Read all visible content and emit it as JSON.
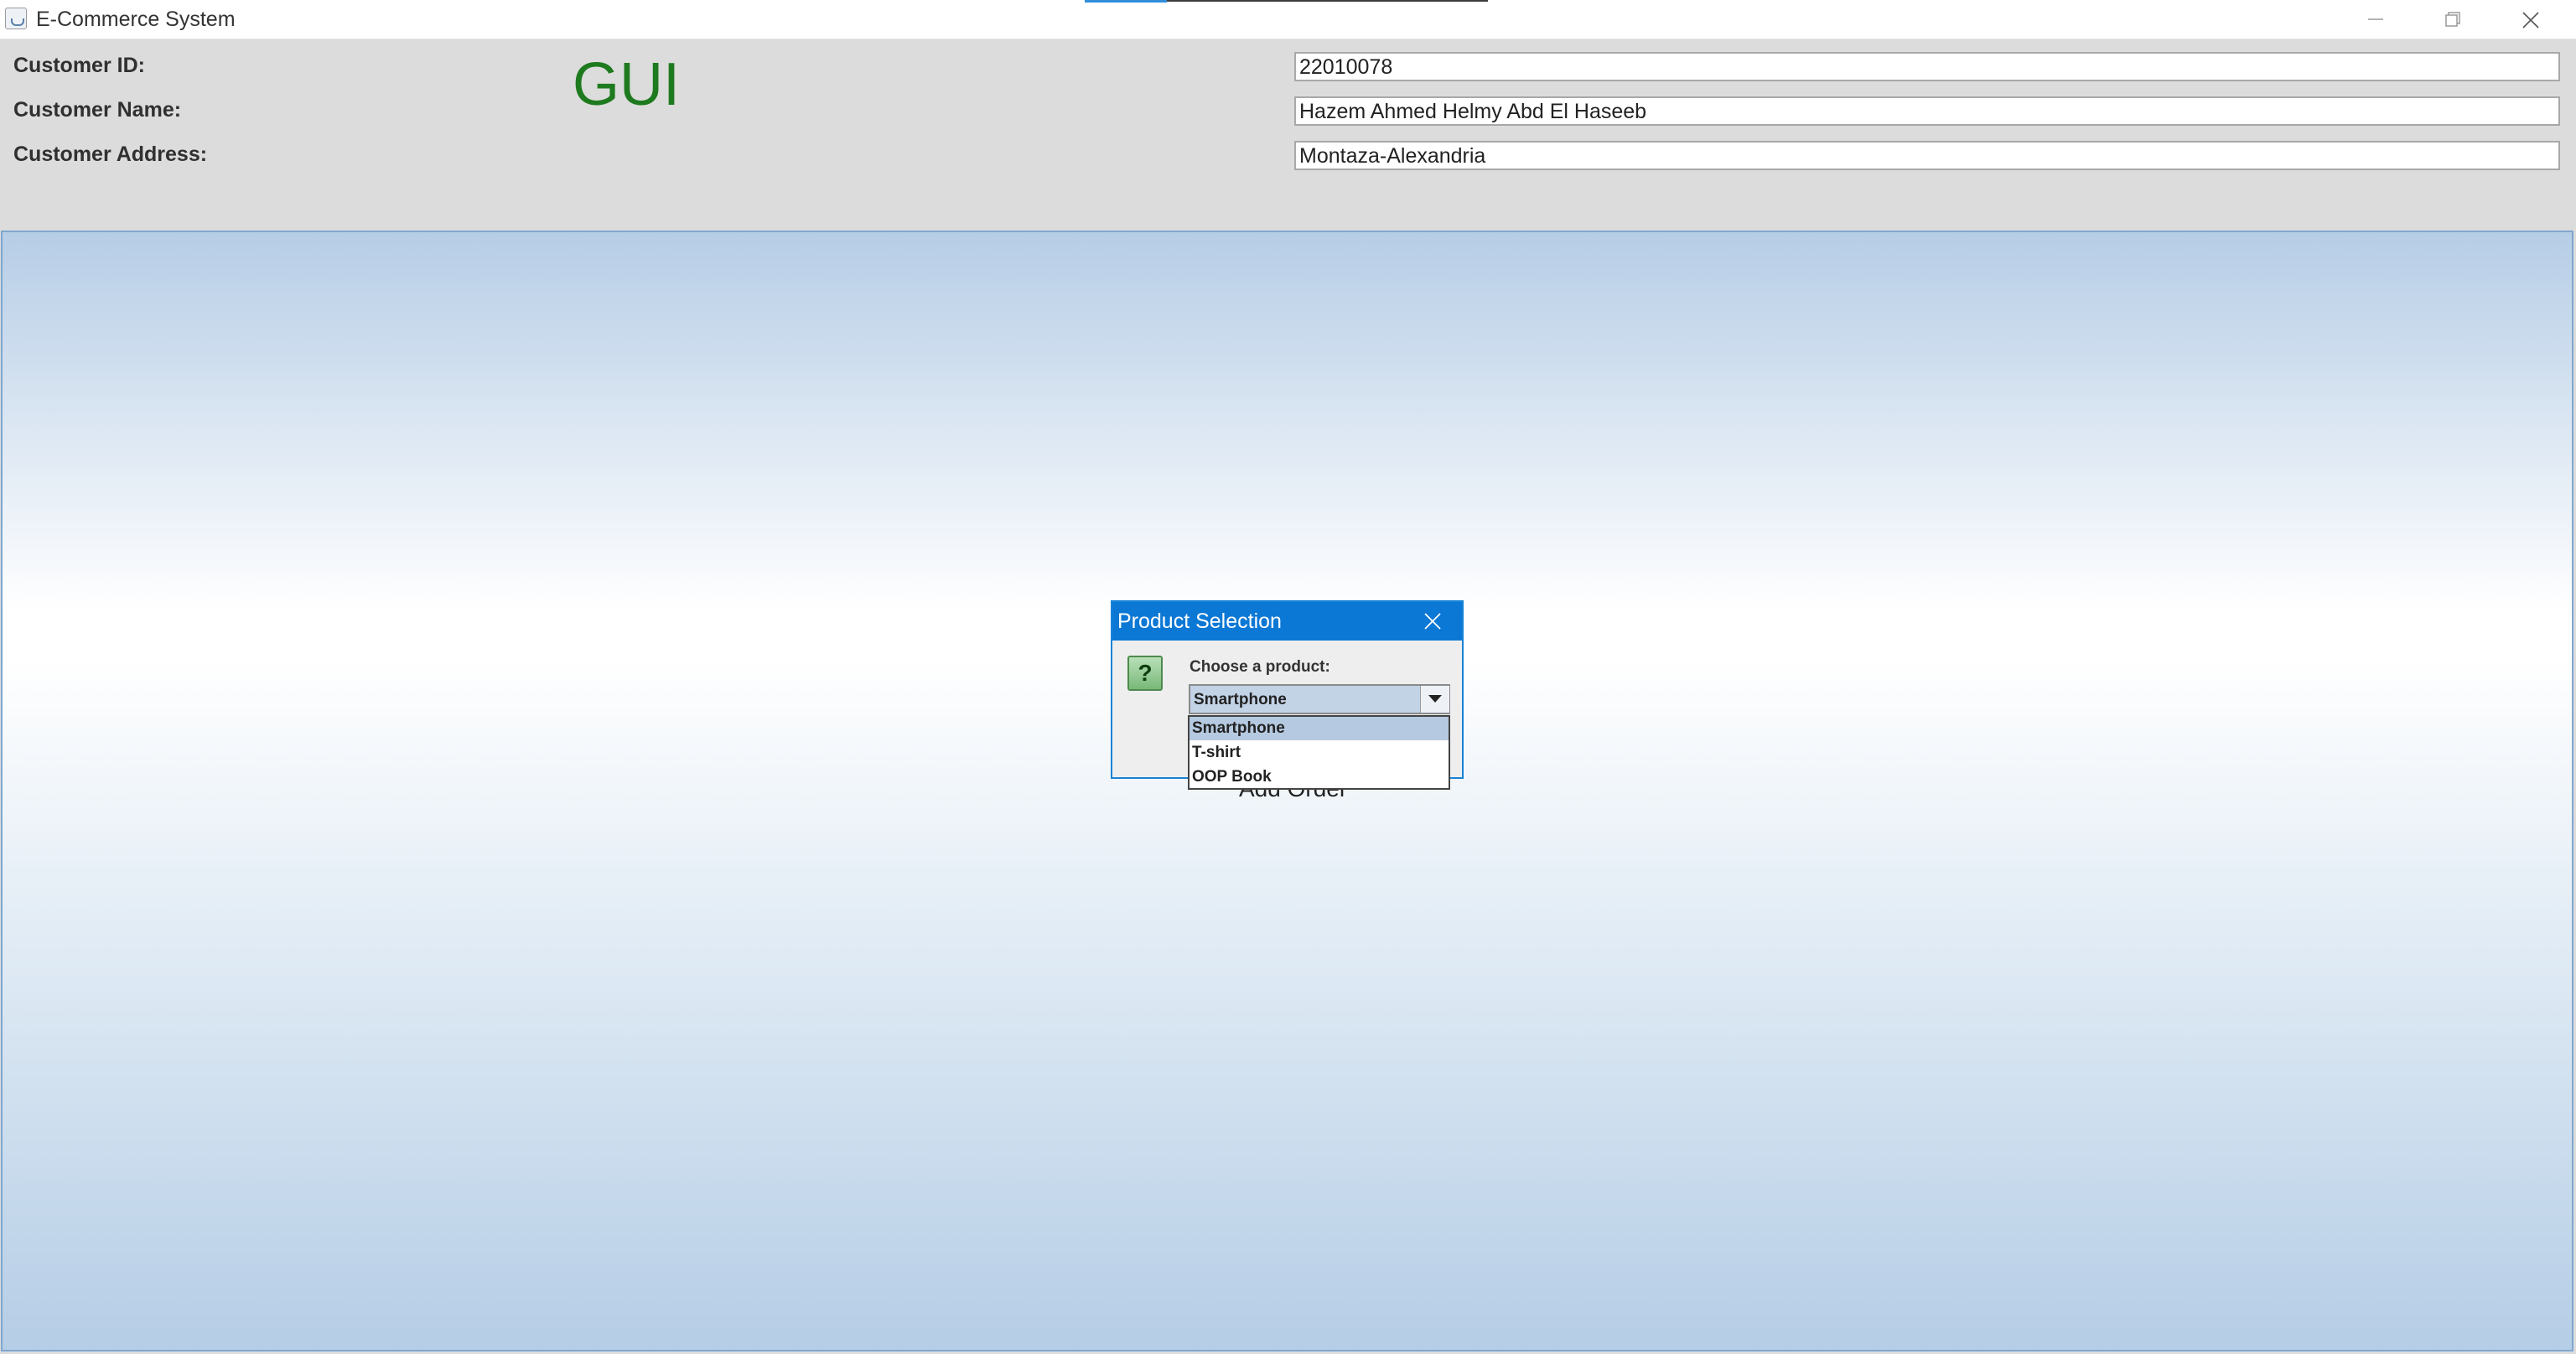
{
  "window": {
    "title": "E-Commerce System",
    "controls": {
      "minimize_icon": "minimize-icon",
      "maximize_icon": "restore-icon",
      "close_icon": "close-icon"
    }
  },
  "form": {
    "customer_id_label": "Customer ID:",
    "customer_name_label": "Customer Name:",
    "customer_address_label": "Customer Address:",
    "gui_label": "GUI",
    "customer_id_value": "22010078",
    "customer_name_value": "Hazem Ahmed Helmy Abd El Haseeb",
    "customer_address_value": "Montaza-Alexandria"
  },
  "main": {
    "add_order_label": "Add Order"
  },
  "dialog": {
    "title": "Product Selection",
    "icon": "question-icon",
    "prompt": "Choose a product:",
    "selected_value": "Smartphone",
    "options": [
      "Smartphone",
      "T-shirt",
      "OOP Book"
    ],
    "highlighted_index": 0
  },
  "colors": {
    "accent": "#0c78d5",
    "gui_text": "#1e7a1e",
    "selection": "#b5c9e0",
    "panel_bg": "#dcdcdc"
  }
}
